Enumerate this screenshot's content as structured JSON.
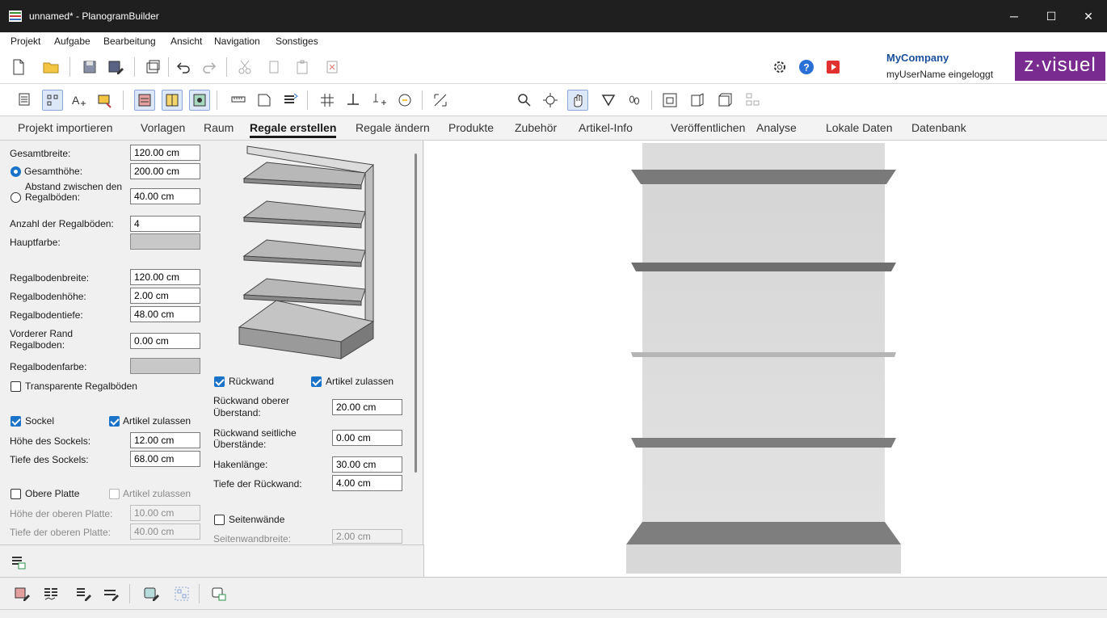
{
  "window": {
    "title": "unnamed* - PlanogramBuilder"
  },
  "menu": [
    "Projekt",
    "Aufgabe",
    "Bearbeitung",
    "Ansicht",
    "Navigation",
    "Sonstiges"
  ],
  "account": {
    "company": "MyCompany",
    "user": "myUserName eingeloggt",
    "logo_text": "z·visuel"
  },
  "tabs": [
    "Projekt importieren",
    "Vorlagen",
    "Raum",
    "Regale erstellen",
    "Regale ändern",
    "Produkte",
    "Zubehör",
    "Artikel-Info",
    "Veröffentlichen",
    "Analyse",
    "Lokale Daten",
    "Datenbank"
  ],
  "active_tab": "Regale erstellen",
  "form": {
    "gesamtbreite": {
      "label": "Gesamtbreite:",
      "value": "120.00 cm"
    },
    "gesamthoehe": {
      "label": "Gesamthöhe:",
      "value": "200.00 cm",
      "selected": true
    },
    "abstand": {
      "label1": "Abstand zwischen den",
      "label2": "Regalböden:",
      "value": "40.00 cm",
      "selected": false
    },
    "anzahl": {
      "label": "Anzahl der Regalböden:",
      "value": "4"
    },
    "hauptfarbe": {
      "label": "Hauptfarbe:",
      "color": "#c8c8c8"
    },
    "regalbodenbreite": {
      "label": "Regalbodenbreite:",
      "value": "120.00 cm"
    },
    "regalbodenhoehe": {
      "label": "Regalbodenhöhe:",
      "value": "2.00 cm"
    },
    "regalbodentiefe": {
      "label": "Regalbodentiefe:",
      "value": "48.00 cm"
    },
    "vorderer_rand": {
      "label1": "Vorderer Rand",
      "label2": "Regalboden:",
      "value": "0.00 cm"
    },
    "regalbodenfarbe": {
      "label": "Regalbodenfarbe:",
      "color": "#c8c8c8"
    },
    "transparente": {
      "label": "Transparente Regalböden",
      "checked": false
    },
    "sockel": {
      "label": "Sockel",
      "checked": true
    },
    "sockel_artikel": {
      "label": "Artikel zulassen",
      "checked": true
    },
    "hoehe_sockel": {
      "label": "Höhe des Sockels:",
      "value": "12.00 cm"
    },
    "tiefe_sockel": {
      "label": "Tiefe des Sockels:",
      "value": "68.00 cm"
    },
    "obere_platte": {
      "label": "Obere Platte",
      "checked": false
    },
    "obere_artikel": {
      "label": "Artikel zulassen",
      "checked": false
    },
    "hoehe_oberen": {
      "label": "Höhe der oberen Platte:",
      "value": "10.00 cm"
    },
    "tiefe_oberen": {
      "label": "Tiefe der oberen Platte:",
      "value": "40.00 cm"
    },
    "rueckwand": {
      "label": "Rückwand",
      "checked": true
    },
    "rueck_artikel": {
      "label": "Artikel zulassen",
      "checked": true
    },
    "rueck_oberer": {
      "label1": "Rückwand oberer",
      "label2": "Überstand:",
      "value": "20.00 cm"
    },
    "rueck_seitlich": {
      "label1": "Rückwand seitliche",
      "label2": "Überstände:",
      "value": "0.00 cm"
    },
    "hakenlaenge": {
      "label": "Hakenlänge:",
      "value": "30.00 cm"
    },
    "tiefe_rueck": {
      "label": "Tiefe der Rückwand:",
      "value": "4.00 cm"
    },
    "seitenwaende": {
      "label": "Seitenwände",
      "checked": false
    },
    "seitenwandbreite": {
      "label": "Seitenwandbreite:",
      "value": "2.00 cm"
    }
  }
}
